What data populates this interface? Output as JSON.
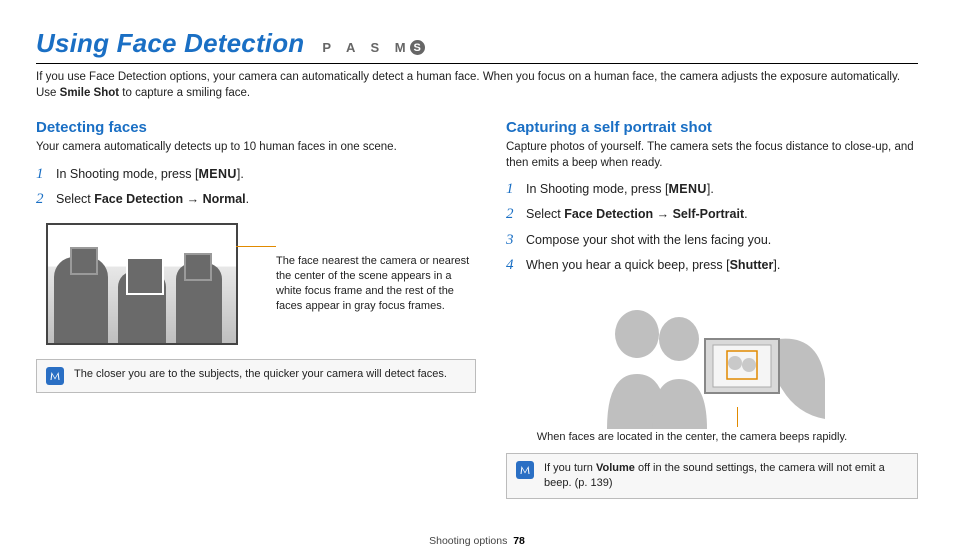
{
  "header": {
    "title": "Using Face Detection",
    "modes": "P A S M",
    "mode_s": "S"
  },
  "intro": {
    "line1": "If you use Face Detection options, your camera can automatically detect a human face. When you focus on a human face, the camera adjusts the exposure automatically. Use ",
    "bold": "Smile Shot",
    "line2": " to capture a smiling face."
  },
  "left": {
    "heading": "Detecting faces",
    "desc": "Your camera automatically detects up to 10 human faces in one scene.",
    "steps": [
      {
        "num": "1",
        "pre": "In Shooting mode, press [",
        "bold": "MENU",
        "post": "]."
      },
      {
        "num": "2",
        "pre": "Select ",
        "bold": "Face Detection",
        "arrow": " → ",
        "bold2": "Normal",
        "post": "."
      }
    ],
    "callout": "The face nearest the camera or nearest the center of the scene appears in a white focus frame and the rest of the faces appear in gray focus frames.",
    "note": "The closer you are to the subjects, the quicker your camera will detect faces."
  },
  "right": {
    "heading": "Capturing a self portrait shot",
    "desc": "Capture photos of yourself. The camera sets the focus distance to close-up, and then emits a beep when ready.",
    "steps": [
      {
        "num": "1",
        "pre": "In Shooting mode, press [",
        "bold": "MENU",
        "post": "]."
      },
      {
        "num": "2",
        "pre": "Select ",
        "bold": "Face Detection",
        "arrow": " → ",
        "bold2": "Self-Portrait",
        "post": "."
      },
      {
        "num": "3",
        "pre": "Compose your shot with the lens facing you."
      },
      {
        "num": "4",
        "pre": "When you hear a quick beep, press [",
        "bold": "Shutter",
        "post": "]."
      }
    ],
    "callout": "When faces are located in the center, the camera beeps rapidly.",
    "note_pre": "If you turn ",
    "note_bold": "Volume",
    "note_post": " off in the sound settings, the camera will not emit a beep. (p. 139)"
  },
  "footer": {
    "section": "Shooting options",
    "page": "78"
  }
}
